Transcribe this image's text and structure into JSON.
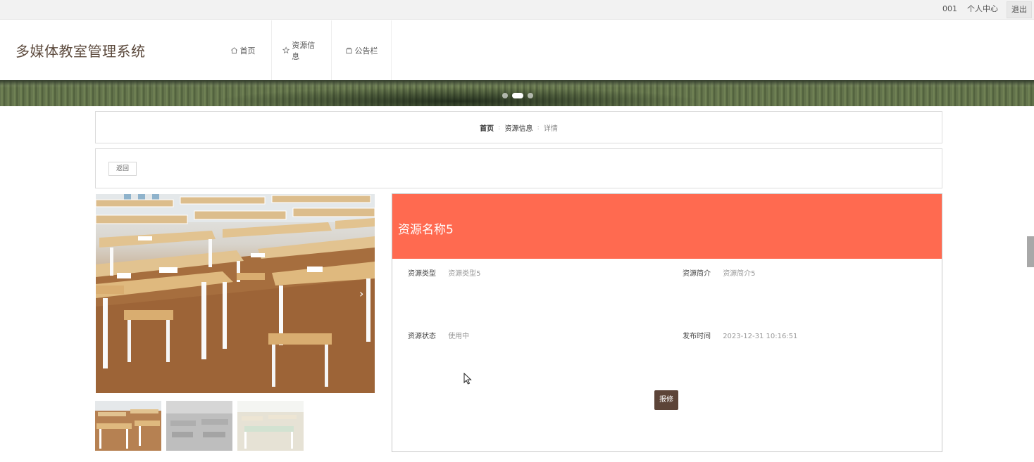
{
  "topbar": {
    "user": "001",
    "personal_center": "个人中心",
    "logout": "退出"
  },
  "header": {
    "logo": "多媒体教室管理系统",
    "nav": [
      {
        "label": "首页",
        "icon": "home-icon"
      },
      {
        "label": "资源信息",
        "icon": "star-icon"
      },
      {
        "label": "公告栏",
        "icon": "bag-icon"
      }
    ]
  },
  "banner": {
    "slides": 3,
    "active_slide": 2
  },
  "breadcrumb": {
    "home": "首页",
    "section": "资源信息",
    "current": "详情",
    "separator": ":"
  },
  "back_button": "返回",
  "detail": {
    "title": "资源名称5",
    "fields": [
      {
        "label": "资源类型",
        "value": "资源类型5"
      },
      {
        "label": "资源简介",
        "value": "资源简介5"
      },
      {
        "label": "资源状态",
        "value": "使用中"
      },
      {
        "label": "发布时间",
        "value": "2023-12-31 10:16:51"
      }
    ],
    "repair_button": "报修"
  },
  "gallery": {
    "thumbnails": 3,
    "next_arrow": "›"
  },
  "colors": {
    "accent": "#ff6a50",
    "button_dark": "#5c4438",
    "logo": "#5c4a3d"
  }
}
